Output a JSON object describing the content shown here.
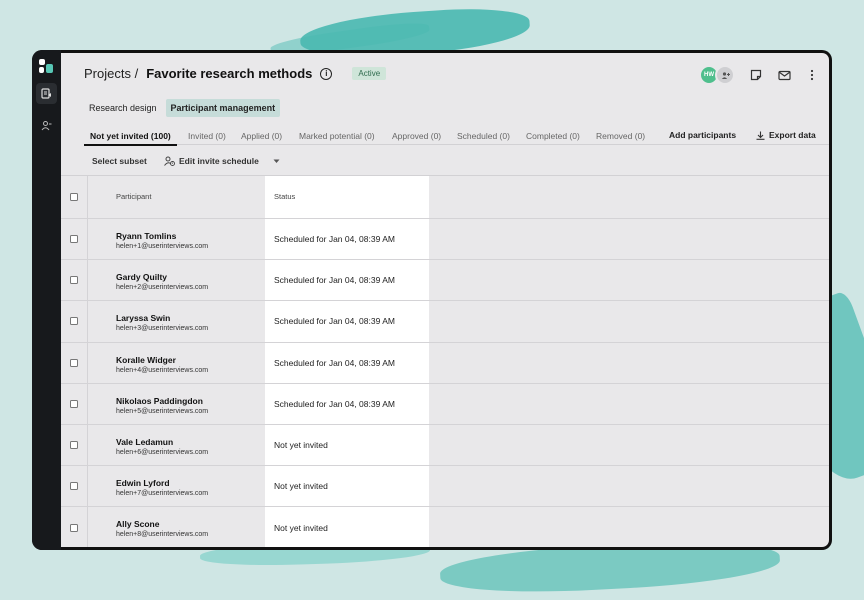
{
  "breadcrumb": {
    "root": "Projects /",
    "title": "Favorite research methods",
    "badge": "Active"
  },
  "user": {
    "initials": "HW",
    "accent": "#4fbf8d"
  },
  "subtabs": [
    {
      "label": "Research design",
      "active": false
    },
    {
      "label": "Participant management",
      "active": true
    }
  ],
  "status_tabs": [
    {
      "label": "Not yet invited (100)",
      "active": true
    },
    {
      "label": "Invited (0)"
    },
    {
      "label": "Applied (0)"
    },
    {
      "label": "Marked potential (0)"
    },
    {
      "label": "Approved (0)"
    },
    {
      "label": "Scheduled (0)"
    },
    {
      "label": "Completed (0)"
    },
    {
      "label": "Removed (0)"
    }
  ],
  "actions": {
    "add": "Add participants",
    "export": "Export data"
  },
  "toolbar": {
    "select_subset": "Select subset",
    "edit_schedule": "Edit invite schedule"
  },
  "table": {
    "headers": {
      "participant": "Participant",
      "status": "Status"
    },
    "rows": [
      {
        "name": "Ryann Tomlins",
        "email": "helen+1@userinterviews.com",
        "status": "Scheduled for Jan 04, 08:39 AM"
      },
      {
        "name": "Gardy Quilty",
        "email": "helen+2@userinterviews.com",
        "status": "Scheduled for Jan 04, 08:39 AM"
      },
      {
        "name": "Laryssa Swin",
        "email": "helen+3@userinterviews.com",
        "status": "Scheduled for Jan 04, 08:39 AM"
      },
      {
        "name": "Koralle Widger",
        "email": "helen+4@userinterviews.com",
        "status": "Scheduled for Jan 04, 08:39 AM"
      },
      {
        "name": "Nikolaos Paddingdon",
        "email": "helen+5@userinterviews.com",
        "status": "Scheduled for Jan 04, 08:39 AM"
      },
      {
        "name": "Vale Ledamun",
        "email": "helen+6@userinterviews.com",
        "status": "Not yet invited"
      },
      {
        "name": "Edwin Lyford",
        "email": "helen+7@userinterviews.com",
        "status": "Not yet invited"
      },
      {
        "name": "Ally Scone",
        "email": "helen+8@userinterviews.com",
        "status": "Not yet invited"
      }
    ]
  }
}
